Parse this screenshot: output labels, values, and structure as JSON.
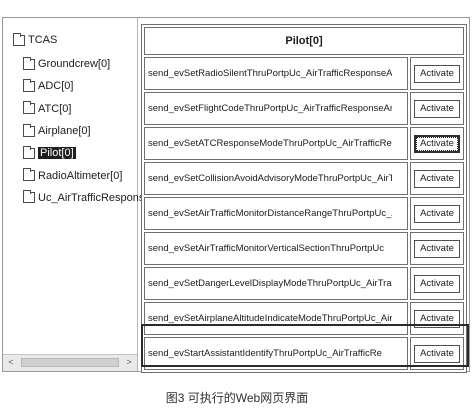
{
  "tree": {
    "root": "TCAS",
    "items": [
      {
        "label": "Groundcrew[0]"
      },
      {
        "label": "ADC[0]"
      },
      {
        "label": "ATC[0]"
      },
      {
        "label": "Airplane[0]"
      },
      {
        "label": "Pilot[0]",
        "selected": true
      },
      {
        "label": "RadioAltimeter[0]"
      },
      {
        "label": "Uc_AirTrafficResponseA"
      }
    ]
  },
  "scrollbar": {
    "left_arrow": "<",
    "right_arrow": ">"
  },
  "table": {
    "header": "Pilot[0]",
    "button_label": "Activate",
    "rows": [
      {
        "method": "send_evSetRadioSilentThruPortpUc_AirTrafficResponseAn"
      },
      {
        "method": "send_evSetFlightCodeThruPortpUc_AirTrafficResponseAnd"
      },
      {
        "method": "send_evSetATCResponseModeThruPortpUc_AirTrafficRespon"
      },
      {
        "method": "send_evSetCollisionAvoidAdvisoryModeThruPortpUc_AirTr"
      },
      {
        "method": "send_evSetAirTrafficMonitorDistanceRangeThruPortpUc_A"
      },
      {
        "method": "send_evSetAirTrafficMonitorVerticalSectionThruPortpUc"
      },
      {
        "method": "send_evSetDangerLevelDisplayModeThruPortpUc_AirTraffi"
      },
      {
        "method": "send_evSetAirplaneAltitudeIndicateModeThruPortpUc_Air"
      },
      {
        "method": "send_evStartAssistantIdentifyThruPortpUc_AirTrafficRe"
      }
    ]
  },
  "caption": "图3 可执行的Web网页界面"
}
